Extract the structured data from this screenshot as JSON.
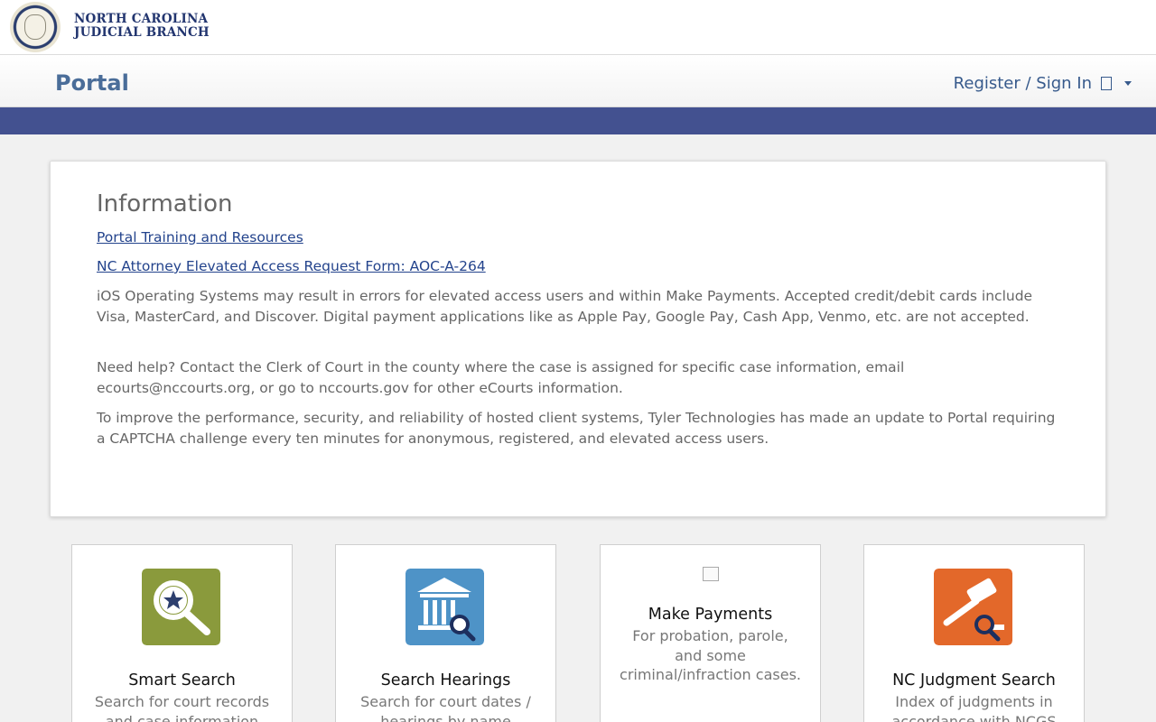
{
  "header": {
    "logo_line1": "NORTH CAROLINA",
    "logo_line2": "JUDICIAL BRANCH"
  },
  "navbar": {
    "brand": "Portal",
    "signin_label": "Register / Sign In"
  },
  "colors": {
    "nav_stripe": "#435190",
    "brand_text": "#4a6d99",
    "link": "#23438c"
  },
  "info": {
    "title": "Information",
    "links": [
      "Portal Training and Resources",
      "NC Attorney Elevated Access Request Form: AOC-A-264"
    ],
    "paragraphs": [
      "iOS Operating Systems may result in errors for elevated access users and within Make Payments. Accepted credit/debit cards include Visa, MasterCard, and Discover. Digital payment applications like as Apple Pay, Google Pay, Cash App, Venmo, etc. are not accepted.",
      "Need help? Contact the Clerk of Court in the county where the case is assigned for specific case information, email ecourts@nccourts.org, or go to nccourts.gov for other eCourts information.",
      "To improve the performance, security, and reliability of hosted client systems, Tyler Technologies has made an update to Portal requiring a CAPTCHA challenge every ten minutes for anonymous, registered, and elevated access users."
    ]
  },
  "tiles": [
    {
      "icon": "smart-search-icon",
      "color": "#8a9a3c",
      "title": "Smart Search",
      "desc": "Search for court records and case information"
    },
    {
      "icon": "search-hearings-icon",
      "color": "#4e93c7",
      "title": "Search Hearings",
      "desc": "Search for court dates / hearings by name"
    },
    {
      "icon": "broken-image-icon",
      "title": "Make Payments",
      "desc": "For probation, parole, and some criminal/infraction cases."
    },
    {
      "icon": "judgment-search-icon",
      "color": "#e3682a",
      "title": "NC Judgment Search",
      "desc": "Index of judgments in accordance with NCGS"
    }
  ]
}
